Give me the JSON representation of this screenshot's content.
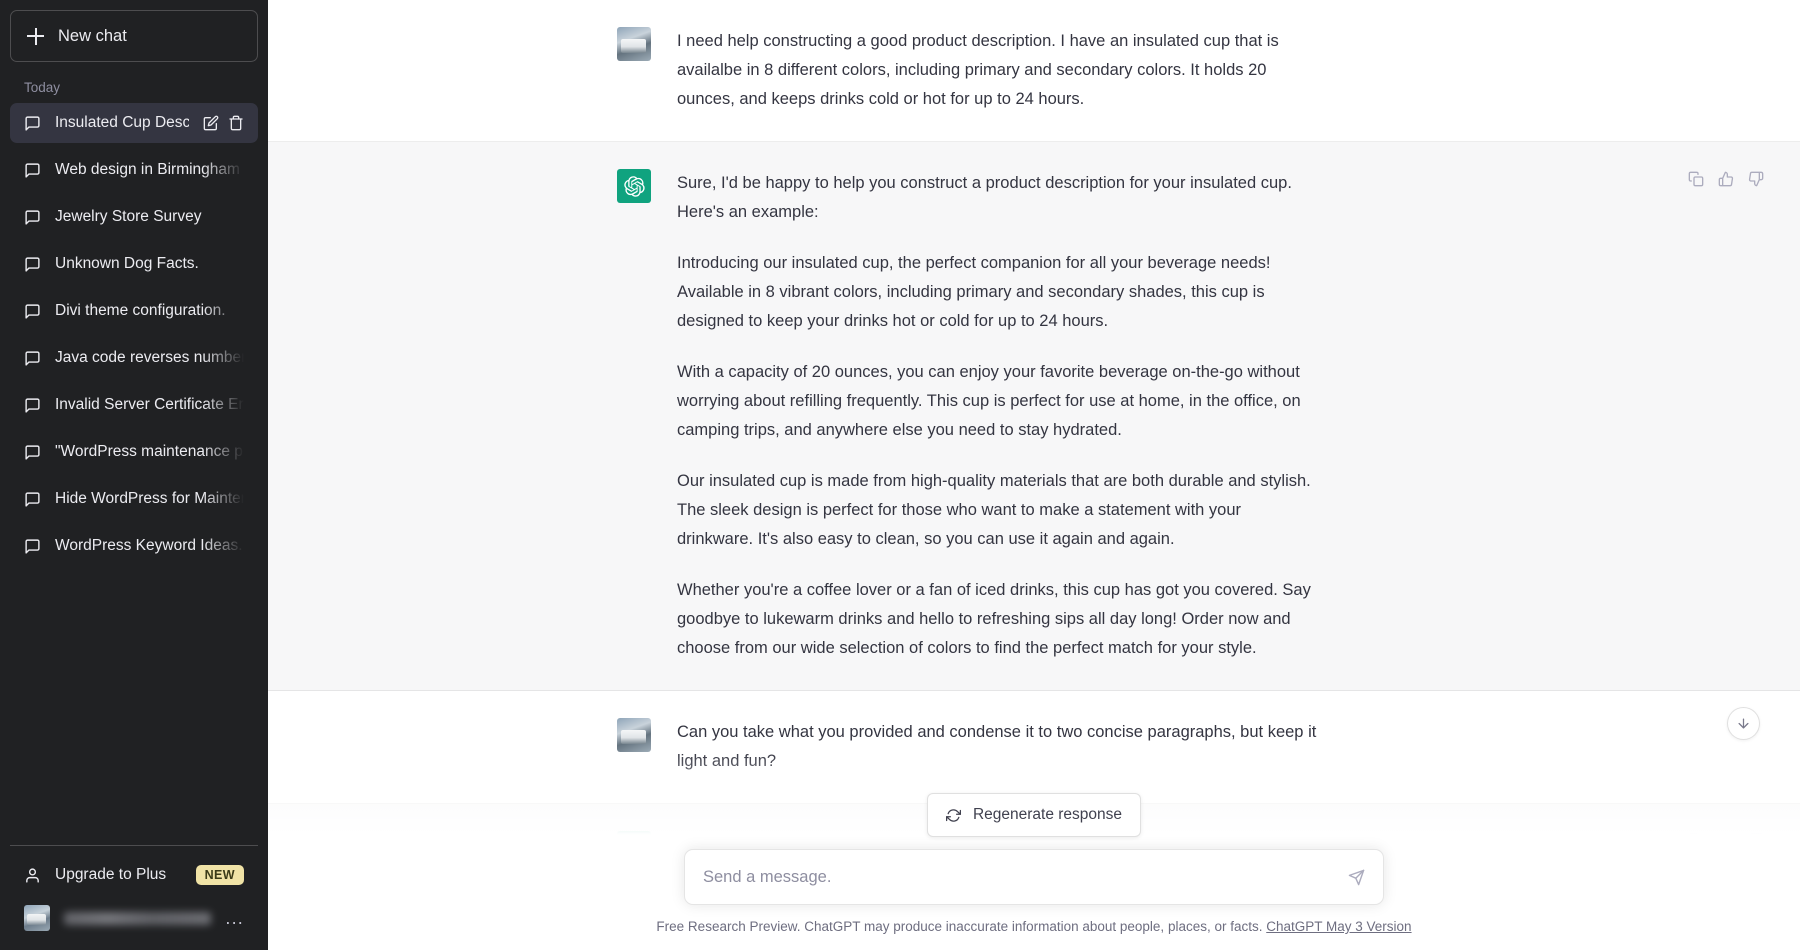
{
  "sidebar": {
    "new_chat_label": "New chat",
    "section_label": "Today",
    "chats": [
      {
        "title": "Insulated Cup Descripti",
        "active": true
      },
      {
        "title": "Web design in Birmingham",
        "active": false
      },
      {
        "title": "Jewelry Store Survey",
        "active": false
      },
      {
        "title": "Unknown Dog Facts.",
        "active": false
      },
      {
        "title": "Divi theme configuration.",
        "active": false
      },
      {
        "title": "Java code reverses numbers.",
        "active": false
      },
      {
        "title": "Invalid Server Certificate Error",
        "active": false
      },
      {
        "title": "\"WordPress maintenance plugi",
        "active": false
      },
      {
        "title": "Hide WordPress for Maintenan",
        "active": false
      },
      {
        "title": "WordPress Keyword Ideas.",
        "active": false
      }
    ],
    "upgrade_label": "Upgrade to Plus",
    "upgrade_badge": "NEW",
    "account_menu_label": "..."
  },
  "conversation": {
    "messages": [
      {
        "role": "user",
        "paragraphs": [
          "I need help constructing a good product description. I have an insulated cup that is availalbe in 8 different colors, including primary and secondary colors. It holds 20 ounces, and keeps drinks cold or hot for up to 24 hours."
        ]
      },
      {
        "role": "assistant",
        "paragraphs": [
          "Sure, I'd be happy to help you construct a product description for your insulated cup. Here's an example:",
          "Introducing our insulated cup, the perfect companion for all your beverage needs! Available in 8 vibrant colors, including primary and secondary shades, this cup is designed to keep your drinks hot or cold for up to 24 hours.",
          "With a capacity of 20 ounces, you can enjoy your favorite beverage on-the-go without worrying about refilling frequently. This cup is perfect for use at home, in the office, on camping trips, and anywhere else you need to stay hydrated.",
          "Our insulated cup is made from high-quality materials that are both durable and stylish. The sleek design is perfect for those who want to make a statement with your drinkware. It's also easy to clean, so you can use it again and again.",
          "Whether you're a coffee lover or a fan of iced drinks, this cup has got you covered. Say goodbye to lukewarm drinks and hello to refreshing sips all day long! Order now and choose from our wide selection of colors to find the perfect match for your style."
        ]
      },
      {
        "role": "user",
        "paragraphs": [
          "Can you take what you provided and condense it to two concise paragraphs, but keep it light and fun?"
        ]
      }
    ]
  },
  "composer": {
    "regenerate_label": "Regenerate response",
    "input_value": "",
    "input_placeholder": "Send a message."
  },
  "footer": {
    "text": "Free Research Preview. ChatGPT may produce inaccurate information about people, places, or facts.",
    "link_text": "ChatGPT May 3 Version"
  },
  "colors": {
    "sidebar_bg": "#202123",
    "active_chat_bg": "#343541",
    "assistant_bg": "#f7f7f8",
    "brand_green": "#10a37f",
    "badge_yellow": "#f0e3a6"
  }
}
